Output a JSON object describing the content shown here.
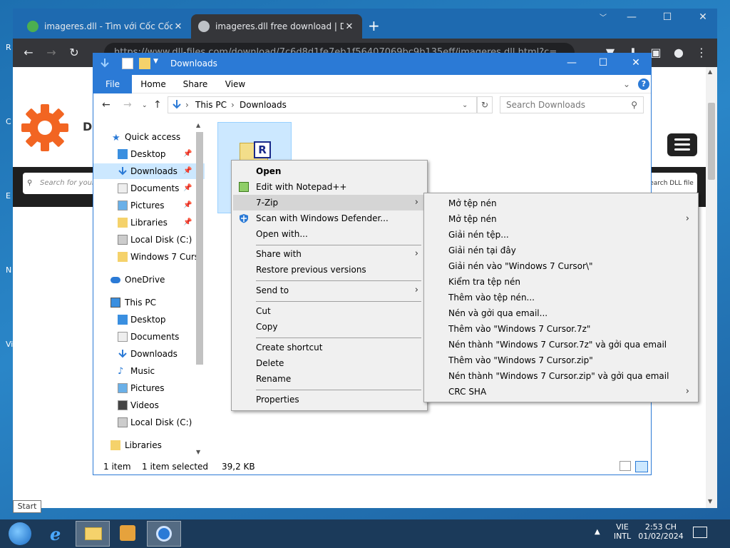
{
  "chrome": {
    "tabs": [
      {
        "title": "imageres.dll - Tìm với Cốc Cốc",
        "close": "✕"
      },
      {
        "title": "imageres.dll free download | DLL",
        "close": "✕"
      }
    ],
    "new_tab": "+",
    "url": "https://www.dll-files.com/download/7c6d8d1fe7eb1f56407069bc9b135eff/imageres.dll.html?c=",
    "page": {
      "site_title": "DL",
      "search_placeholder": "Search for your",
      "search_button": "earch DLL file"
    }
  },
  "explorer": {
    "title": "Downloads",
    "ribbon_tabs": [
      "File",
      "Home",
      "Share",
      "View"
    ],
    "breadcrumb": [
      "This PC",
      "Downloads"
    ],
    "search_placeholder": "Search Downloads",
    "nav": {
      "quick_access": "Quick access",
      "qa_items": [
        "Desktop",
        "Downloads",
        "Documents",
        "Pictures",
        "Libraries",
        "Local Disk (C:)",
        "Windows 7 Curs"
      ],
      "onedrive": "OneDrive",
      "this_pc": "This PC",
      "pc_items": [
        "Desktop",
        "Documents",
        "Downloads",
        "Music",
        "Pictures",
        "Videos",
        "Local Disk (C:)"
      ],
      "libraries": "Libraries"
    },
    "status": {
      "items": "1 item",
      "selected": "1 item selected",
      "size": "39,2 KB"
    }
  },
  "context_menu": {
    "items": [
      "Open",
      "Edit with Notepad++",
      "7-Zip",
      "Scan with Windows Defender...",
      "Open with...",
      "Share with",
      "Restore previous versions",
      "Send to",
      "Cut",
      "Copy",
      "Create shortcut",
      "Delete",
      "Rename",
      "Properties"
    ]
  },
  "zip_menu": {
    "items": [
      "Mở tệp nén",
      "Mở tệp nén",
      "Giải nén tệp...",
      "Giải nén tại đây",
      "Giải nén vào \"Windows 7 Cursor\\\"",
      "Kiểm tra tệp nén",
      "Thêm vào tệp nén...",
      "Nén và gởi qua email...",
      "Thêm vào \"Windows 7 Cursor.7z\"",
      "Nén thành \"Windows 7 Cursor.7z\" và gởi qua email",
      "Thêm vào \"Windows 7 Cursor.zip\"",
      "Nén thành \"Windows 7 Cursor.zip\" và gởi qua email",
      "CRC SHA"
    ]
  },
  "taskbar": {
    "start_tooltip": "Start",
    "lang": "VIE",
    "layout": "INTL",
    "time": "2:53 CH",
    "date": "01/02/2024"
  },
  "colors": {
    "explorer_accent": "#2b7ad6",
    "chrome_tabstrip": "#1e6ab0",
    "gear_orange": "#f26522"
  }
}
